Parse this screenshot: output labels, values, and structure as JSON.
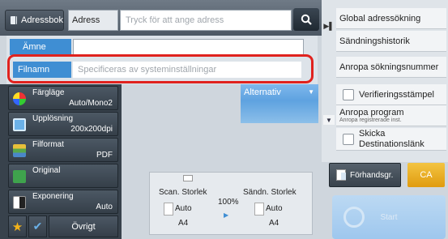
{
  "topbar": {
    "adressbok_label": "Adressbok",
    "adress_label": "Adress",
    "adress_placeholder": "Tryck för att ange adress"
  },
  "fields": {
    "amne_label": "Ämne",
    "amne_value": "",
    "filnamn_label": "Filnamn",
    "filnamn_placeholder": "Specificeras av systeminställningar"
  },
  "alternativ_label": "Alternativ",
  "right_menu": {
    "items": [
      {
        "label": "Global adressökning"
      },
      {
        "label": "Sändningshistorik"
      },
      {
        "label": "Anropa sökningsnummer"
      },
      {
        "label": "Verifieringsstämpel",
        "checkbox": true,
        "checked": false
      },
      {
        "label": "Anropa program",
        "sub": "Anropa registrerade inst."
      },
      {
        "label": "Skicka Destinationslänk",
        "checkbox": true,
        "checked": false
      }
    ]
  },
  "settings": [
    {
      "label": "Färgläge",
      "value": "Auto/Mono2",
      "icon": "color-mode-icon"
    },
    {
      "label": "Upplösning",
      "value": "200x200dpi",
      "icon": "resolution-icon"
    },
    {
      "label": "Filformat",
      "value": "PDF",
      "icon": "file-format-icon"
    },
    {
      "label": "Original",
      "value": "",
      "icon": "original-icon"
    },
    {
      "label": "Exponering",
      "value": "Auto",
      "icon": "exposure-icon"
    }
  ],
  "bottom": {
    "ovrigt_label": "Övrigt"
  },
  "size_panel": {
    "scan_label": "Scan. Storlek",
    "send_label": "Sändn. Storlek",
    "ratio": "100%",
    "scan_auto": "Auto",
    "scan_size": "A4",
    "send_auto": "Auto",
    "send_size": "A4"
  },
  "actions": {
    "forhand_label": "Förhandsgr.",
    "ca_label": "CA",
    "start_label": "Start"
  },
  "colors": {
    "accent_blue": "#3f8ed3",
    "highlight_red": "#e0221e",
    "ca_orange": "#e8a71c"
  }
}
